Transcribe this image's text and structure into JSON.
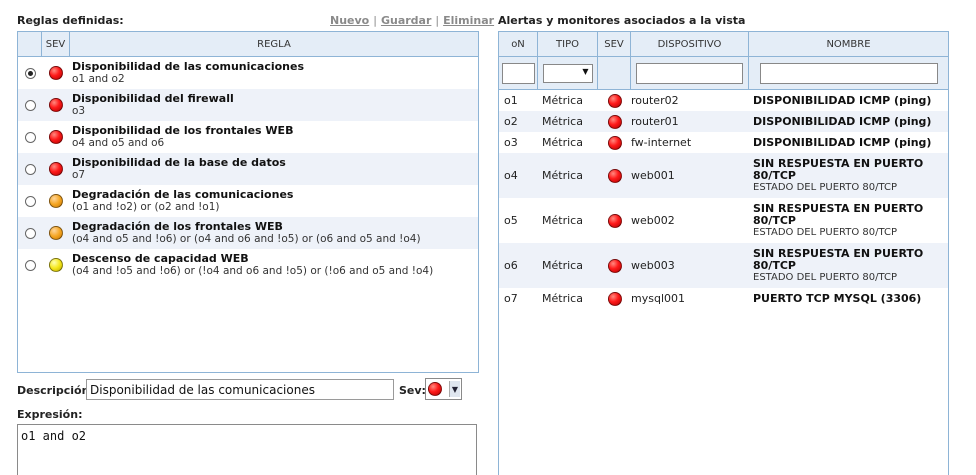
{
  "left": {
    "title": "Reglas definidas:",
    "links": {
      "nuevo": "Nuevo",
      "guardar": "Guardar",
      "eliminar": "Eliminar"
    },
    "headers": {
      "sev": "SEV",
      "regla": "REGLA"
    },
    "rules": [
      {
        "name": "Disponibilidad de las comunicaciones",
        "expr": "o1 and o2",
        "sev": "red",
        "selected": true
      },
      {
        "name": "Disponibilidad del firewall",
        "expr": "o3",
        "sev": "red",
        "selected": false
      },
      {
        "name": "Disponibilidad de los frontales WEB",
        "expr": "o4 and o5 and o6",
        "sev": "red",
        "selected": false
      },
      {
        "name": "Disponibilidad de la base de datos",
        "expr": "o7",
        "sev": "red",
        "selected": false
      },
      {
        "name": "Degradación de las comunicaciones",
        "expr": "(o1 and !o2) or (o2 and !o1)",
        "sev": "orange",
        "selected": false
      },
      {
        "name": "Degradación de los frontales WEB",
        "expr": "(o4 and o5 and !o6) or (o4 and o6 and !o5) or (o6 and o5 and !o4)",
        "sev": "orange",
        "selected": false
      },
      {
        "name": "Descenso de capacidad WEB",
        "expr": "(o4 and !o5 and !o6) or (!o4 and o6 and !o5) or (!o6 and o5 and !o4)",
        "sev": "yellow",
        "selected": false
      }
    ],
    "description_label": "Descripción:",
    "description_value": "Disponibilidad de las comunicaciones",
    "sev_label": "Sev:",
    "sev_value": "red",
    "expression_label": "Expresión:",
    "expression_value": "o1 and o2"
  },
  "right": {
    "title": "Alertas y monitores asociados a la vista",
    "headers": {
      "on": "oN",
      "tipo": "TIPO",
      "sev": "SEV",
      "dispositivo": "DISPOSITIVO",
      "nombre": "NOMBRE"
    },
    "rows": [
      {
        "id": "o1",
        "tipo": "Métrica",
        "sev": "red",
        "disp": "router02",
        "name": "DISPONIBILIDAD ICMP (ping)",
        "sub": ""
      },
      {
        "id": "o2",
        "tipo": "Métrica",
        "sev": "red",
        "disp": "router01",
        "name": "DISPONIBILIDAD ICMP (ping)",
        "sub": ""
      },
      {
        "id": "o3",
        "tipo": "Métrica",
        "sev": "red",
        "disp": "fw-internet",
        "name": "DISPONIBILIDAD ICMP (ping)",
        "sub": ""
      },
      {
        "id": "o4",
        "tipo": "Métrica",
        "sev": "red",
        "disp": "web001",
        "name": "SIN RESPUESTA EN PUERTO 80/TCP",
        "sub": "ESTADO DEL PUERTO 80/TCP"
      },
      {
        "id": "o5",
        "tipo": "Métrica",
        "sev": "red",
        "disp": "web002",
        "name": "SIN RESPUESTA EN PUERTO 80/TCP",
        "sub": "ESTADO DEL PUERTO 80/TCP"
      },
      {
        "id": "o6",
        "tipo": "Métrica",
        "sev": "red",
        "disp": "web003",
        "name": "SIN RESPUESTA EN PUERTO 80/TCP",
        "sub": "ESTADO DEL PUERTO 80/TCP"
      },
      {
        "id": "o7",
        "tipo": "Métrica",
        "sev": "red",
        "disp": "mysql001",
        "name": "PUERTO TCP MYSQL (3306)",
        "sub": ""
      }
    ]
  }
}
